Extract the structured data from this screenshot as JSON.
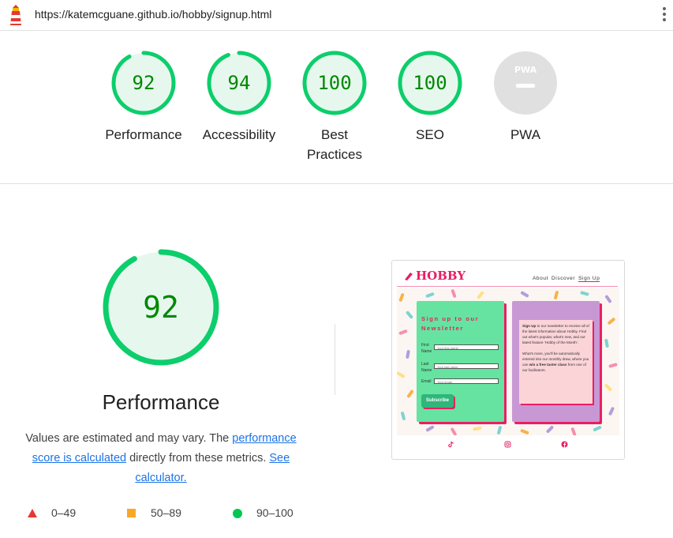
{
  "browser": {
    "url": "https://katemcguane.github.io/hobby/signup.html"
  },
  "scores": [
    {
      "label": "Performance",
      "value": "92"
    },
    {
      "label": "Accessibility",
      "value": "94"
    },
    {
      "label": "Best Practices",
      "value": "100"
    },
    {
      "label": "SEO",
      "value": "100"
    },
    {
      "label": "PWA",
      "value": "",
      "badge": "PWA"
    }
  ],
  "main": {
    "score": "92",
    "title": "Performance",
    "desc_prefix": "Values are estimated and may vary. The ",
    "desc_link1": "performance score is calculated",
    "desc_middle": " directly from these metrics. ",
    "desc_link2": "See calculator."
  },
  "legend": [
    {
      "range": "0–49",
      "color": "#e53935"
    },
    {
      "range": "50–89",
      "color": "#f9a825"
    },
    {
      "range": "90–100",
      "color": "#00c853"
    }
  ],
  "colors": {
    "pass": "#0cce6b",
    "pass_text": "#008800",
    "pass_bg": "#e6f8ee",
    "inactive": "#e0e0e0"
  },
  "thumbnail": {
    "logo": "HOBBY",
    "nav": [
      "About",
      "Discover",
      "Sign Up"
    ],
    "form_title": "Sign up to our Newsletter",
    "fields": [
      {
        "label": "First Name",
        "placeholder": "Your first name"
      },
      {
        "label": "Last Name",
        "placeholder": "Your last name"
      },
      {
        "label": "Email",
        "placeholder": "Your email"
      }
    ],
    "button": "Subscribe",
    "info_p1_bold": "Sign Up",
    "info_p1": " to our newsletter to receive all of the latest information about Hobby. Find out what's popular, what's new, and our latest feature 'Hobby of the Month'.",
    "info_p2": "What's more, you'll be automatically entered into our monthly draw, where you can ",
    "info_p2_bold": "win a free taster class",
    "info_p2_end": " from one of our facilitators.",
    "social_icons": [
      "tiktok-icon",
      "instagram-icon",
      "facebook-icon"
    ]
  }
}
